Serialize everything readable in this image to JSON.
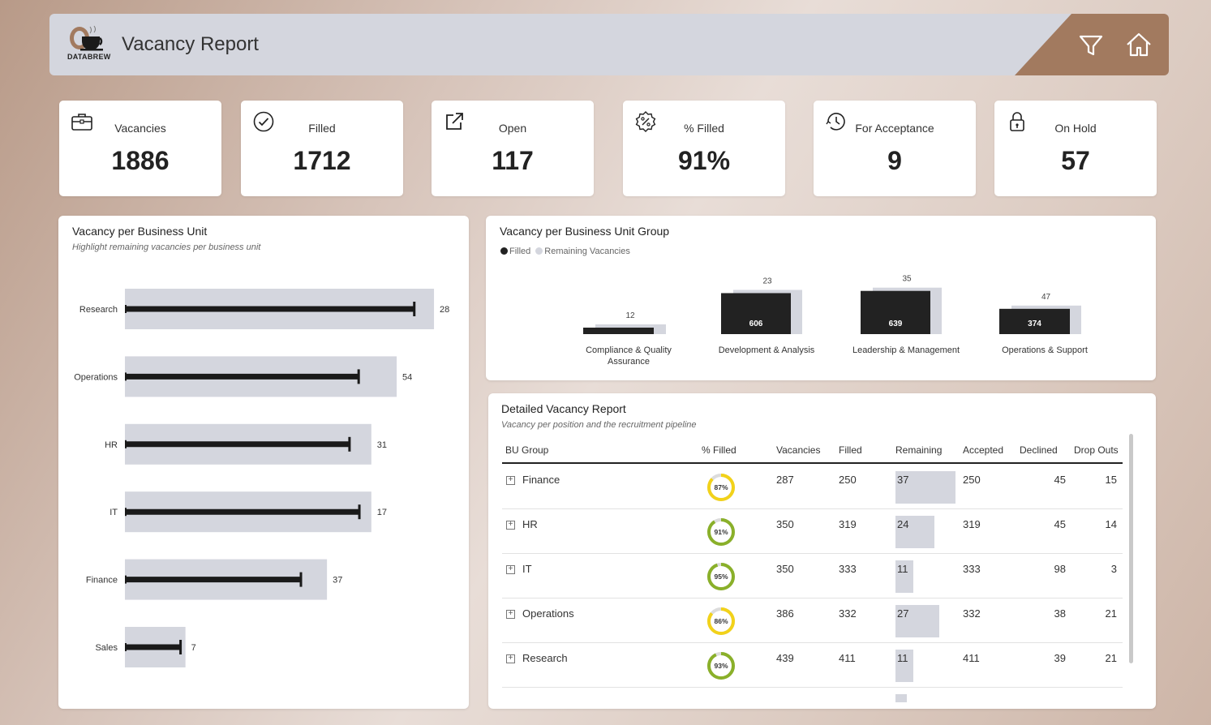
{
  "header": {
    "title": "Vacancy Report",
    "logo_text": "DATABREW",
    "filter_icon": "filter-icon",
    "home_icon": "home-icon",
    "accent": "#a27a5f"
  },
  "kpis": [
    {
      "label": "Vacancies",
      "value": "1886",
      "icon": "briefcase-icon"
    },
    {
      "label": "Filled",
      "value": "1712",
      "icon": "check-circle-icon"
    },
    {
      "label": "Open",
      "value": "117",
      "icon": "external-link-icon"
    },
    {
      "label": "% Filled",
      "value": "91%",
      "icon": "percent-badge-icon"
    },
    {
      "label": "For Acceptance",
      "value": "9",
      "icon": "refresh-clock-icon"
    },
    {
      "label": "On Hold",
      "value": "57",
      "icon": "lock-icon"
    }
  ],
  "bu_panel": {
    "title": "Vacancy per Business Unit",
    "subtitle": "Highlight remaining vacancies per business unit"
  },
  "group_panel": {
    "title": "Vacancy per Business Unit Group",
    "legend": [
      "Filled",
      "Remaining Vacancies"
    ]
  },
  "chart_data": [
    {
      "type": "bar",
      "title": "Vacancy per Business Unit",
      "subtitle": "Highlight remaining vacancies per business unit",
      "orientation": "horizontal",
      "categories": [
        "Research",
        "Operations",
        "HR",
        "IT",
        "Finance",
        "Sales"
      ],
      "series": [
        {
          "values": [
            439,
            386,
            350,
            350,
            287,
            86
          ]
        },
        {
          "values": [
            411,
            332,
            319,
            333,
            250,
            79
          ]
        }
      ],
      "labels": [
        28,
        54,
        31,
        17,
        37,
        7
      ]
    },
    {
      "type": "bar",
      "title": "Vacancy per Business Unit Group",
      "categories": [
        "Compliance & Quality Assurance",
        "Development & Analysis",
        "Leadership & Management",
        "Operations & Support"
      ],
      "series": [
        {
          "name": "Filled",
          "values": [
            null,
            606,
            639,
            374
          ]
        },
        {
          "name": "Remaining Vacancies",
          "values": [
            12,
            23,
            35,
            47
          ]
        }
      ],
      "colors": {
        "Filled": "#222222",
        "Remaining Vacancies": "#d4d6de"
      }
    }
  ],
  "table_panel": {
    "title": "Detailed Vacancy Report",
    "subtitle": "Vacancy per position and the recruitment pipeline",
    "columns": [
      "BU Group",
      "% Filled",
      "Vacancies",
      "Filled",
      "Remaining",
      "Accepted",
      "Declined",
      "Drop Outs"
    ],
    "rows": [
      {
        "group": "Finance",
        "pct": "87%",
        "pct_value": 0.87,
        "ring": "#f2d21a",
        "vacancies": "287",
        "filled": "250",
        "remaining": "37",
        "remaining_value": 37,
        "accepted": "250",
        "declined": "45",
        "dropouts": "15"
      },
      {
        "group": "HR",
        "pct": "91%",
        "pct_value": 0.91,
        "ring": "#8ab02a",
        "vacancies": "350",
        "filled": "319",
        "remaining": "24",
        "remaining_value": 24,
        "accepted": "319",
        "declined": "45",
        "dropouts": "14"
      },
      {
        "group": "IT",
        "pct": "95%",
        "pct_value": 0.95,
        "ring": "#8ab02a",
        "vacancies": "350",
        "filled": "333",
        "remaining": "11",
        "remaining_value": 11,
        "accepted": "333",
        "declined": "98",
        "dropouts": "3"
      },
      {
        "group": "Operations",
        "pct": "86%",
        "pct_value": 0.86,
        "ring": "#f2d21a",
        "vacancies": "386",
        "filled": "332",
        "remaining": "27",
        "remaining_value": 27,
        "accepted": "332",
        "declined": "38",
        "dropouts": "21"
      },
      {
        "group": "Research",
        "pct": "93%",
        "pct_value": 0.93,
        "ring": "#8ab02a",
        "vacancies": "439",
        "filled": "411",
        "remaining": "11",
        "remaining_value": 11,
        "accepted": "411",
        "declined": "39",
        "dropouts": "21"
      }
    ]
  }
}
